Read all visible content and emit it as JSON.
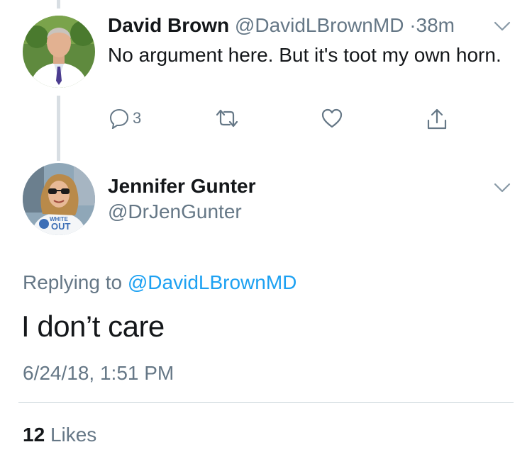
{
  "tweet1": {
    "author_name": "David Brown",
    "author_handle": "@DavidLBrownMD",
    "separator": "·",
    "time": "38m",
    "text": "No argument here. But it's toot my own horn.",
    "reply_count": "3",
    "avatar_icon": "avatar-man-white-coat"
  },
  "tweet2": {
    "author_name": "Jennifer Gunter",
    "author_handle": "@DrJenGunter",
    "replying_prefix": "Replying to",
    "replying_to": "@DavidLBrownMD",
    "text": "I don’t care",
    "timestamp": "6/24/18, 1:51 PM",
    "likes_count": "12",
    "likes_label": "Likes",
    "avatar_icon": "avatar-woman-sunglasses",
    "shirt_text": "WHITE OUT"
  },
  "colors": {
    "text": "#14171a",
    "secondary": "#657786",
    "link": "#1da1f2",
    "thread_line": "#d8dee3",
    "divider": "#cfd9de"
  },
  "icons": [
    "chevron-down-icon",
    "reply-icon",
    "retweet-icon",
    "like-icon",
    "share-icon"
  ]
}
